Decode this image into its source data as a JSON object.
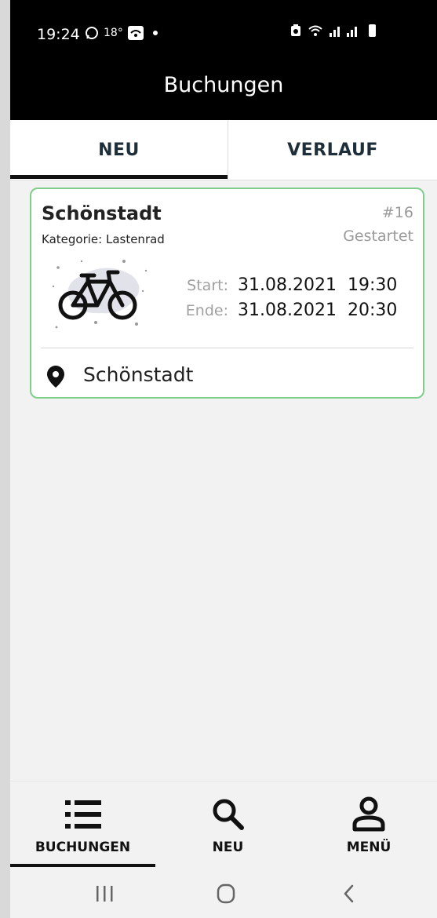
{
  "status_bar": {
    "time": "19:24",
    "temperature": "18°"
  },
  "header": {
    "title": "Buchungen"
  },
  "tabs": [
    {
      "label": "NEU",
      "active": true
    },
    {
      "label": "VERLAUF",
      "active": false
    }
  ],
  "booking": {
    "location_name": "Schönstadt",
    "number": "#16",
    "category": "Kategorie: Lastenrad",
    "status": "Gestartet",
    "start_label": "Start:",
    "start_date": "31.08.2021",
    "start_time": "19:30",
    "end_label": "Ende:",
    "end_date": "31.08.2021",
    "end_time": "20:30",
    "address": "Schönstadt",
    "icon": "bicycle-icon"
  },
  "bottom_nav": [
    {
      "label": "BUCHUNGEN",
      "icon": "list-icon",
      "active": true
    },
    {
      "label": "NEU",
      "icon": "search-icon",
      "active": false
    },
    {
      "label": "MENÜ",
      "icon": "user-icon",
      "active": false
    }
  ],
  "colors": {
    "header_bg": "#000000",
    "card_border": "#7fce8c",
    "muted_text": "#9a9a9a",
    "page_bg": "#f2f2f2"
  }
}
